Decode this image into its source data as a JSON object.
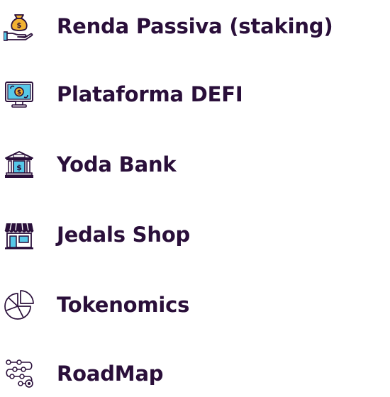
{
  "colors": {
    "text": "#2a0f3a",
    "icon_outline": "#2a0f3a",
    "icon_accent": "#f2b233",
    "icon_blue": "#56c8e8",
    "icon_green": "#77c265",
    "icon_pink": "#f28aa0",
    "icon_orange": "#f29a33"
  },
  "menu": {
    "items": [
      {
        "label": "Renda Passiva (staking)",
        "icon": "money-bag-hand-icon"
      },
      {
        "label": "Plataforma DEFI",
        "icon": "monitor-exchange-icon"
      },
      {
        "label": "Yoda Bank",
        "icon": "bank-icon"
      },
      {
        "label": "Jedals Shop",
        "icon": "shop-icon"
      },
      {
        "label": "Tokenomics",
        "icon": "pie-chart-icon"
      },
      {
        "label": "RoadMap",
        "icon": "roadmap-icon"
      }
    ]
  }
}
